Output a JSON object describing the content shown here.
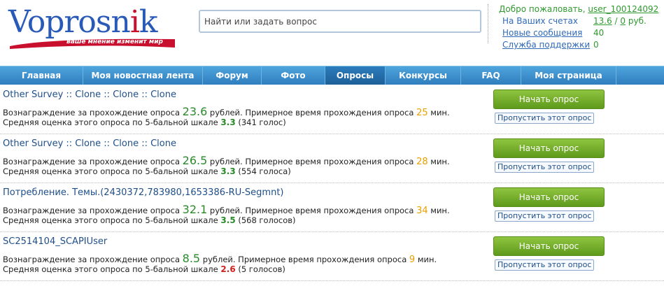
{
  "logo": {
    "text": "Vopros",
    "text_2": "n",
    "text_3": "k",
    "tagline": "ваше мнение изменит мир",
    "colors": {
      "primary": "#2a5ab8",
      "accent": "#c8102e"
    }
  },
  "search": {
    "placeholder": "Найти или задать вопрос"
  },
  "user_panel": {
    "welcome_prefix": "Добро пожаловать,",
    "username": "user_100124092",
    "accounts_label": "На Ваших счетах",
    "balance_1": "13.6",
    "balance_sep": " / ",
    "balance_2": "0",
    "balance_unit": " руб.",
    "messages_label": "Новые сообщения",
    "messages_count": "40",
    "support_label": "Служба поддержки",
    "support_count": "0"
  },
  "nav": {
    "items": [
      {
        "label": "Главная"
      },
      {
        "label": "Моя новостная лента"
      },
      {
        "label": "Форум"
      },
      {
        "label": "Фото"
      },
      {
        "label": "Опросы"
      },
      {
        "label": "Конкурсы"
      },
      {
        "label": "FAQ"
      },
      {
        "label": "Моя страница"
      }
    ],
    "active_index": 4
  },
  "surveys": [
    {
      "title": "Other Survey :: Clone :: Clone :: Clone",
      "reward_prefix": "Вознаграждение за прохождение опроса ",
      "reward": "23.6",
      "reward_suffix": " рублей. Примерное время прохождения опроса ",
      "minutes": "25",
      "minutes_suffix": " мин.",
      "rating_prefix": "Средняя оценка этого опроса по 5-бальной шкале ",
      "rating": "3.3",
      "votes": " (341 голос)",
      "start_label": "Начать опрос",
      "skip_label": "Пропустить этот опрос"
    },
    {
      "title": "Other Survey :: Clone :: Clone :: Clone",
      "reward_prefix": "Вознаграждение за прохождение опроса ",
      "reward": "26.5",
      "reward_suffix": " рублей. Примерное время прохождения опроса ",
      "minutes": "28",
      "minutes_suffix": " мин.",
      "rating_prefix": "Средняя оценка этого опроса по 5-бальной шкале ",
      "rating": "3.3",
      "votes": " (554 голоса)",
      "start_label": "Начать опрос",
      "skip_label": "Пропустить этот опрос"
    },
    {
      "title": "Потребление. Темы.(2430372,783980,1653386-RU-Segmnt)",
      "reward_prefix": "Вознаграждение за прохождение опроса ",
      "reward": "32.1",
      "reward_suffix": " рублей. Примерное время прохождения опроса ",
      "minutes": "34",
      "minutes_suffix": " мин.",
      "rating_prefix": "Средняя оценка этого опроса по 5-бальной шкале ",
      "rating": "3.5",
      "votes": " (568 голосов)",
      "start_label": "Начать опрос",
      "skip_label": "Пропустить этот опрос"
    },
    {
      "title": "SC2514104_SCAPIUser",
      "reward_prefix": "Вознаграждение за прохождение опроса ",
      "reward": "8.5",
      "reward_suffix": " рублей. Примерное время прохождения опроса ",
      "minutes": "9",
      "minutes_suffix": " мин.",
      "rating_prefix": "Средняя оценка этого опроса по 5-бальной шкале ",
      "rating": "2.6",
      "votes": " (5 голосов)",
      "start_label": "Начать опрос",
      "skip_label": "Пропустить этот опрос"
    }
  ],
  "colors": {
    "nav_bg": "#3a8fd0",
    "reward": "#2a8a2a",
    "minutes": "#e8a000",
    "rating_low": "#d02020",
    "start_button": "#6fae28"
  }
}
